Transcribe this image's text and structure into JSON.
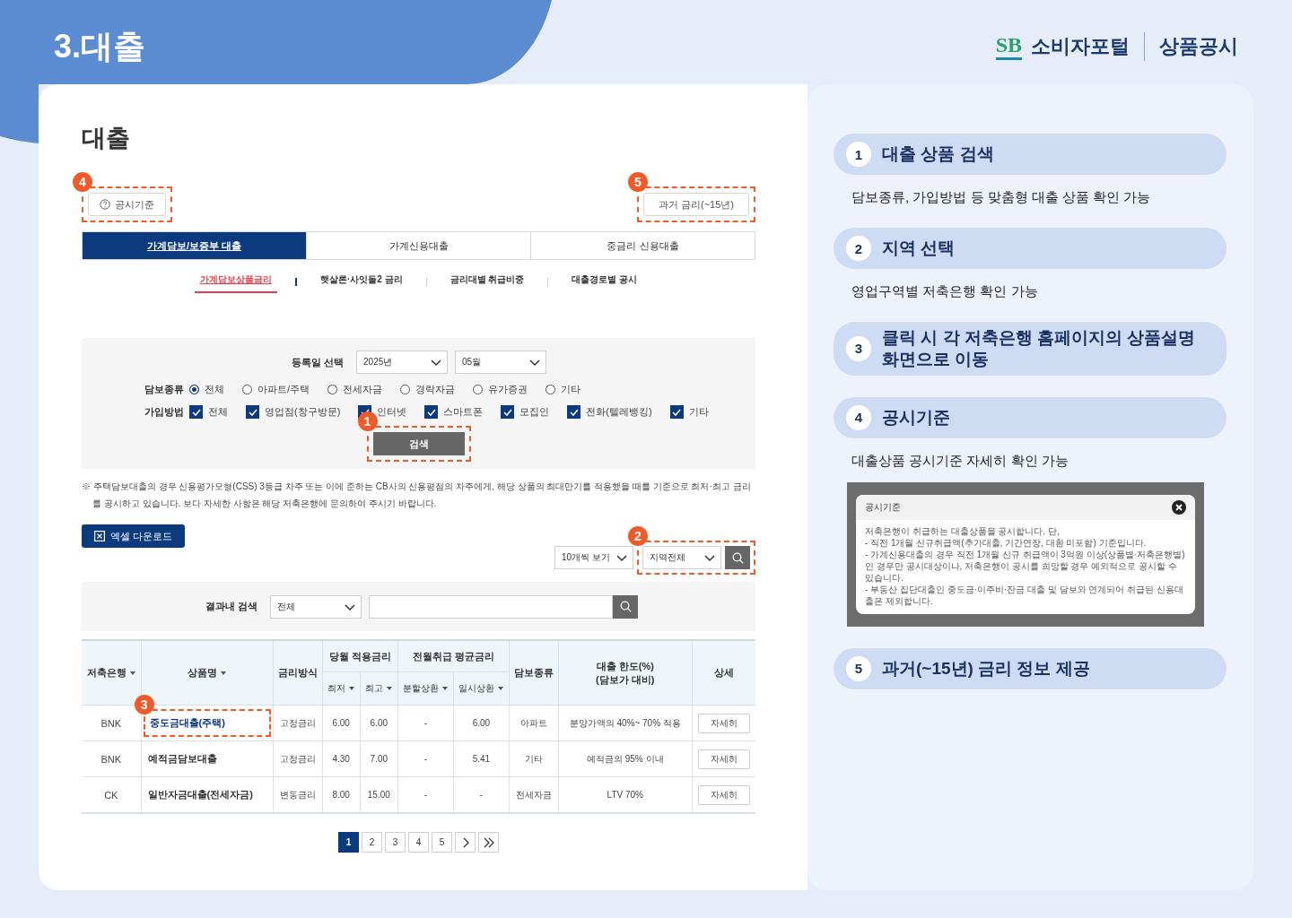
{
  "header": {
    "title": "3.대출",
    "logo_mark": "SB",
    "brand": "소비자포털",
    "section": "상품공시"
  },
  "page": {
    "heading": "대출",
    "criteria_button": "공시기준",
    "criteria_marker": "4",
    "past_rates_button": "과거 금리(~15년)",
    "past_marker": "5"
  },
  "tabs": [
    {
      "label": "가계담보/보증부 대출",
      "selected": true
    },
    {
      "label": "가계신용대출",
      "selected": false
    },
    {
      "label": "중금리 신용대출",
      "selected": false
    }
  ],
  "subtabs": [
    {
      "label": "가계담보상품금리",
      "selected": true
    },
    {
      "label": "햇살론·사잇돌2 금리",
      "selected": false
    },
    {
      "label": "금리대별 취급비중",
      "selected": false
    },
    {
      "label": "대출경로별 공시",
      "selected": false
    }
  ],
  "filters": {
    "date_label": "등록일 선택",
    "year": "2025년",
    "month": "05월",
    "collateral_label": "담보종류",
    "collateral_options": [
      {
        "label": "전체",
        "selected": true
      },
      {
        "label": "아파트/주택",
        "selected": false
      },
      {
        "label": "전세자금",
        "selected": false
      },
      {
        "label": "경락자금",
        "selected": false
      },
      {
        "label": "유가증권",
        "selected": false
      },
      {
        "label": "기타",
        "selected": false
      }
    ],
    "method_label": "가입방법",
    "method_options": [
      {
        "label": "전체",
        "checked": true
      },
      {
        "label": "영업점(창구방문)",
        "checked": true
      },
      {
        "label": "인터넷",
        "checked": true
      },
      {
        "label": "스마트폰",
        "checked": true
      },
      {
        "label": "모집인",
        "checked": true
      },
      {
        "label": "전화(텔레뱅킹)",
        "checked": true
      },
      {
        "label": "기타",
        "checked": true
      }
    ],
    "search_button": "검색",
    "search_marker": "1"
  },
  "notice": "※ 주택담보대출의 경우 신용평가모형(CSS) 3등급 차주 또는 이에 준하는 CB사의 신용평점의 차주에게, 해당 상품의 최대만기를 적용했을 때를 기준으로 최저·최고 금리를 공시하고 있습니다. 보다 자세한 사항은 해당 저축은행에 문의하여 주시기 바랍니다.",
  "excel_button": "엑셀 다운로드",
  "page_size": "10개씩 보기",
  "region": "지역전체",
  "region_marker": "2",
  "result_search": {
    "label": "결과내 검색",
    "scope": "전체"
  },
  "table": {
    "column_groups": [
      {
        "label": "당월 적용금리"
      },
      {
        "label": "전월취급 평균금리"
      }
    ],
    "columns": [
      {
        "label": "저축은행",
        "sortable": true
      },
      {
        "label": "상품명",
        "sortable": true
      },
      {
        "label": "금리방식",
        "sortable": false
      },
      {
        "label": "최저",
        "sortable": true,
        "grouped": true,
        "group_start": true
      },
      {
        "label": "최고",
        "sortable": true,
        "grouped": true
      },
      {
        "label": "분할상환",
        "sortable": true,
        "grouped": true,
        "group_start": true
      },
      {
        "label": "일시상환",
        "sortable": true,
        "grouped": true
      },
      {
        "label": "담보종류",
        "sortable": false
      },
      {
        "label": "대출 한도(%)\n(담보가 대비)",
        "sortable": false
      },
      {
        "label": "상세",
        "sortable": false
      }
    ],
    "rows": [
      {
        "highlighted": true,
        "marker": "3",
        "cells": [
          "BNK",
          "중도금대출(주택)",
          "고정금리",
          "6.00",
          "6.00",
          "-",
          "6.00",
          "아파트",
          "분양가액의 40%~ 70% 적용"
        ],
        "detail": "자세히"
      },
      {
        "highlighted": false,
        "cells": [
          "BNK",
          "예적금담보대출",
          "고정금리",
          "4.30",
          "7.00",
          "-",
          "5.41",
          "기타",
          "예적금의 95% 이내"
        ],
        "detail": "자세히"
      },
      {
        "highlighted": false,
        "cells": [
          "CK",
          "일반자금대출(전세자금)",
          "변동금리",
          "8.00",
          "15.00",
          "-",
          "-",
          "전세자금",
          "LTV 70%"
        ],
        "detail": "자세히"
      }
    ]
  },
  "pagination": {
    "pages": [
      {
        "label": "1",
        "selected": true
      },
      {
        "label": "2",
        "selected": false
      },
      {
        "label": "3",
        "selected": false
      },
      {
        "label": "4",
        "selected": false
      },
      {
        "label": "5",
        "selected": false
      }
    ]
  },
  "guide": [
    {
      "number": "1",
      "title": "대출 상품 검색",
      "description": "담보종류, 가입방법 등 맞춤형 대출 상품 확인 가능"
    },
    {
      "number": "2",
      "title": "지역 선택",
      "description": "영업구역별 저축은행 확인 가능"
    },
    {
      "number": "3",
      "title": "클릭 시 각 저축은행 홈페이지의 상품설명\n화면으로 이동"
    },
    {
      "number": "4",
      "title": "공시기준",
      "description": "대출상품 공시기준 자세히 확인 가능",
      "inset": {
        "title": "공시기준",
        "lines": [
          "저축은행이 취급하는 대출상품을 공시합니다. 단,",
          "- 직전 1개월 신규취급액(추가대출, 기간연장, 대환 미포함) 기준입니다.",
          "- 가계신용대출의 경우 직전 1개월 신규 취급액이 3억원 이상(상품별·저축은행별) 인 경우만 공시대상이나, 저축은행이 공시를 희망할 경우 예외적으로 공시할 수 있습니다.",
          "- 부동산 집단대출인 중도금·이주비·잔금 대출 및 담보와 연계되어 취급된 신용대출은 제외합니다."
        ]
      }
    },
    {
      "number": "5",
      "title": "과거(~15년) 금리 정보 제공"
    }
  ]
}
